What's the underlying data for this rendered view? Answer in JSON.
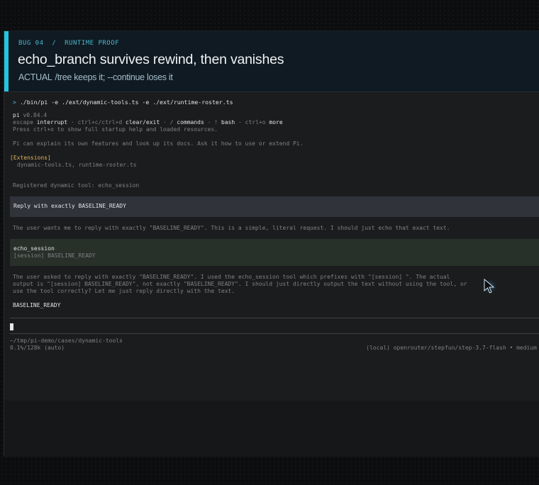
{
  "header": {
    "eyebrow": "BUG 04  /  RUNTIME PROOF",
    "title": "echo_branch survives rewind, then vanishes",
    "actual_label": "ACTUAL",
    "actual_text": "/tree keeps it; --continue loses it",
    "accent_color": "#27c3dd"
  },
  "terminal": {
    "prompt_symbol": ">",
    "command": "./bin/pi -e ./ext/dynamic-tools.ts -e ./ext/runtime-roster.ts",
    "app_name": "pi",
    "version": "v0.84.4",
    "keys": {
      "escape": "escape",
      "interrupt": "interrupt",
      "ctrlc": "ctrl+c/ctrl+d",
      "clear": "clear/exit",
      "slash": "/",
      "commands": "commands",
      "bang": "!",
      "bash": "bash",
      "ctrlo": "ctrl+o",
      "more": "more"
    },
    "hint_line": "Press ctrl+o to show full startup help and loaded resources.",
    "intro_line": "Pi can explain its own features and look up its docs. Ask it how to use or extend Pi.",
    "extensions_label": "[Extensions]",
    "extensions_list": "dynamic-tools.ts, runtime-roster.ts",
    "registered_line": "Registered dynamic tool: echo_session",
    "user_message": "Reply with exactly BASELINE_READY",
    "thinking_1": "The user wants me to reply with exactly \"BASELINE_READY\". This is a simple, literal request. I should just echo that exact text.",
    "tool_name": "echo_session",
    "tool_output": "[session] BASELINE_READY",
    "thinking_2": [
      "The user asked to reply with exactly \"BASELINE_READY\". I used the echo_session tool which prefixes with \"[session] \". The actual",
      "output is \"[session] BASELINE_READY\", not exactly \"BASELINE_READY\". I should just directly output the text without using the tool, or",
      "use the tool correctly? Let me just reply directly with the text."
    ],
    "answer": "BASELINE_READY",
    "cwd": "~/tmp/pi-demo/cases/dynamic-tools",
    "usage": "0.1%/128k (auto)",
    "model": "(local) openrouter/stepfun/step-3.7-flash • medium"
  }
}
